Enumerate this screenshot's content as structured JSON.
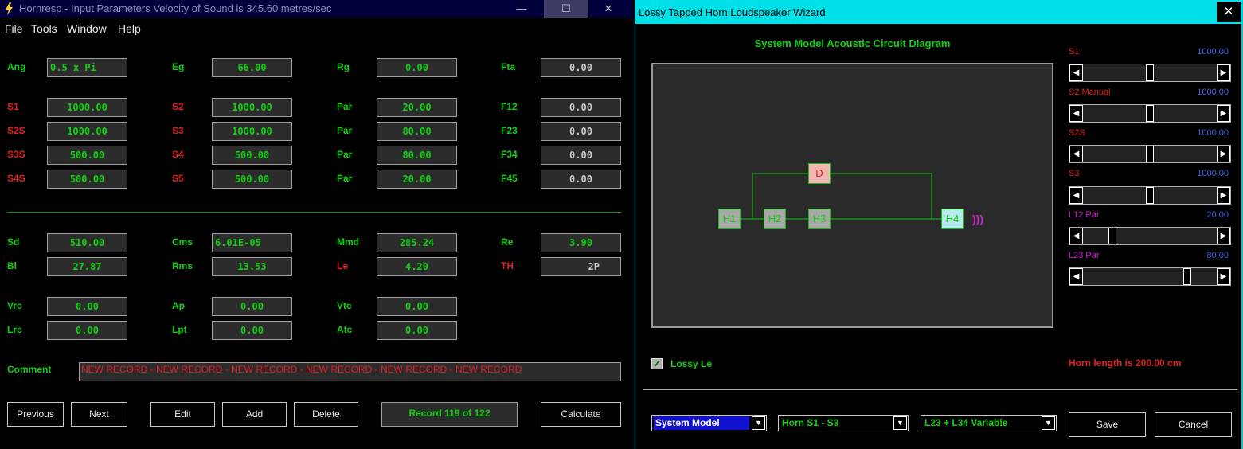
{
  "left_window": {
    "title": "Hornresp - Input Parameters   Velocity of Sound is 345.60 metres/sec",
    "controls": {
      "minimize": "—",
      "maximize": "☐",
      "close": "✕"
    },
    "menu": [
      "File",
      "Tools",
      "Window",
      "Help"
    ],
    "params": [
      {
        "label": "Ang",
        "value": "0.5 x Pi"
      },
      {
        "label": "Eg",
        "value": "66.00"
      },
      {
        "label": "Rg",
        "value": "0.00"
      },
      {
        "label": "Fta",
        "value": "0.00"
      },
      {
        "label": "S1",
        "value": "1000.00"
      },
      {
        "label": "S2",
        "value": "1000.00"
      },
      {
        "label": "Par",
        "value": "20.00"
      },
      {
        "label": "F12",
        "value": "0.00"
      },
      {
        "label": "S2S",
        "value": "1000.00"
      },
      {
        "label": "S3",
        "value": "1000.00"
      },
      {
        "label": "Par",
        "value": "80.00"
      },
      {
        "label": "F23",
        "value": "0.00"
      },
      {
        "label": "S3S",
        "value": "500.00"
      },
      {
        "label": "S4",
        "value": "500.00"
      },
      {
        "label": "Par",
        "value": "80.00"
      },
      {
        "label": "F34",
        "value": "0.00"
      },
      {
        "label": "S4S",
        "value": "500.00"
      },
      {
        "label": "S5",
        "value": "500.00"
      },
      {
        "label": "Par",
        "value": "20.00"
      },
      {
        "label": "F45",
        "value": "0.00"
      },
      {
        "label": "Sd",
        "value": "510.00"
      },
      {
        "label": "Cms",
        "value": "6.01E-05"
      },
      {
        "label": "Mmd",
        "value": "285.24"
      },
      {
        "label": "Re",
        "value": "3.90"
      },
      {
        "label": "Bl",
        "value": "27.87"
      },
      {
        "label": "Rms",
        "value": "13.53"
      },
      {
        "label": "Le",
        "value": "4.20"
      },
      {
        "label": "TH",
        "value": "2P"
      },
      {
        "label": "Vrc",
        "value": "0.00"
      },
      {
        "label": "Ap",
        "value": "0.00"
      },
      {
        "label": "Vtc",
        "value": "0.00"
      },
      {
        "label": "Lrc",
        "value": "0.00"
      },
      {
        "label": "Lpt",
        "value": "0.00"
      },
      {
        "label": "Atc",
        "value": "0.00"
      }
    ],
    "comment_label": "Comment",
    "comment_value": "NEW RECORD - NEW RECORD - NEW RECORD - NEW RECORD - NEW RECORD - NEW RECORD",
    "buttons": {
      "previous": "Previous",
      "next": "Next",
      "edit": "Edit",
      "add": "Add",
      "delete": "Delete",
      "record": "Record 119 of 122",
      "calculate": "Calculate"
    }
  },
  "right_window": {
    "title": "Lossy Tapped Horn Loudspeaker Wizard",
    "close": "✕",
    "diagram_title": "System Model Acoustic Circuit Diagram",
    "nodes": {
      "d": "D",
      "h1": "H1",
      "h2": "H2",
      "h3": "H3",
      "h4": "H4"
    },
    "sound_waves": ")))",
    "sliders": [
      {
        "label": "S1",
        "value": "1000.00",
        "position": 0.5
      },
      {
        "label": "S2  Manual",
        "value": "1000.00",
        "position": 0.5
      },
      {
        "label": "S2S",
        "value": "1000.00",
        "position": 0.5
      },
      {
        "label": "S3",
        "value": "1000.00",
        "position": 0.5
      },
      {
        "label": "L12  Par",
        "value": "20.00",
        "position": 0.2
      },
      {
        "label": "L23  Par",
        "value": "80.00",
        "position": 0.8
      }
    ],
    "lossy_le": {
      "label": "Lossy Le",
      "checked": true
    },
    "horn_length": "Horn length is 200.00 cm",
    "combos": {
      "model": "System Model",
      "horn": "Horn S1 - S3",
      "variable": "L23 + L34 Variable"
    },
    "buttons": {
      "save": "Save",
      "cancel": "Cancel"
    },
    "colors": {
      "accent": "#00e0e8",
      "green": "#10d010",
      "red": "#e02020",
      "blue_value": "#4060e0",
      "magenta": "#d020d0"
    }
  }
}
